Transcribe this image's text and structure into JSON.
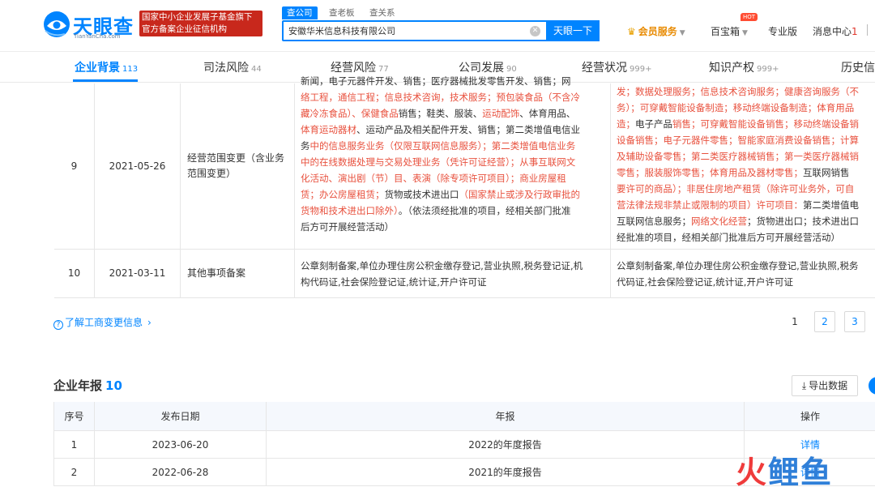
{
  "header": {
    "logo_name": "天眼查",
    "logo_sub": "TianYanCha.com",
    "gov_badge_line1": "国家中小企业发展子基金旗下",
    "gov_badge_line2": "官方备案企业征信机构",
    "search_tabs": [
      "查公司",
      "查老板",
      "查关系"
    ],
    "search_value": "安徽华米信息科技有限公司",
    "search_button": "天眼一下",
    "vip": "会员服务",
    "baibaoxiang": "百宝箱",
    "hot": "HOT",
    "pro": "专业版",
    "messages": "消息中心",
    "message_count": "1"
  },
  "tabs": [
    {
      "label": "企业背景",
      "count": "113"
    },
    {
      "label": "司法风险",
      "count": "44"
    },
    {
      "label": "经营风险",
      "count": "77"
    },
    {
      "label": "公司发展",
      "count": "90"
    },
    {
      "label": "经营状况",
      "count": "999+"
    },
    {
      "label": "知识产权",
      "count": "999+"
    },
    {
      "label": "历史信",
      "count": ""
    }
  ],
  "change_rows": [
    {
      "no": "9",
      "date": "2021-05-26",
      "item": "经营范围变更（含业务范围变更）",
      "before_lines": [
        [
          [
            "新闻，电子元器件开发、销售；医疗器械批发零售开发、销售；网",
            false
          ]
        ],
        [
          [
            "络工程，通信工程；信息技术咨询，技术服务；预包装食品（不含冷",
            true
          ]
        ],
        [
          [
            "藏冷冻食品）、保健食品",
            true
          ],
          [
            "销售；鞋类、服装、",
            false
          ],
          [
            "运动配饰",
            true
          ],
          [
            "、体育用品、",
            false
          ]
        ],
        [
          [
            "体育运动器材",
            true
          ],
          [
            "、运动产品及相关配件开发、销售；第二类增值电信业",
            false
          ]
        ],
        [
          [
            "务",
            false
          ],
          [
            "中的信息服务业务（仅限互联网信息服务）；第二类增值电信业务",
            true
          ]
        ],
        [
          [
            "中的在线数据处理与交易处理业务（凭许可证经营）；从事互联网文",
            true
          ]
        ],
        [
          [
            "化活动、演出剧（节）目、表演（除专项许可项目）；商业房屋租",
            true
          ]
        ],
        [
          [
            "赁；办公房屋租赁；",
            true
          ],
          [
            "货物或技术进出口",
            false
          ],
          [
            "（国家禁止或涉及行政审批的",
            true
          ]
        ],
        [
          [
            "货物和技术进出口除外）",
            true
          ],
          [
            "。（依法须经批准的项目，经相关部门批准",
            false
          ]
        ],
        [
          [
            "后方可开展经营活动）",
            false
          ]
        ]
      ],
      "after_lines": [
        [
          [
            "发；数据处理服务；信息技术咨询服务；健康咨询服务（不",
            true
          ]
        ],
        [
          [
            "务）；可穿戴智能设备制造；移动终端设备制造；体育用品",
            true
          ]
        ],
        [
          [
            "造；",
            true
          ],
          [
            "电子产品",
            false
          ],
          [
            "销售；可穿戴智能设备销售；移动终端设备销",
            true
          ]
        ],
        [
          [
            "设备销售；电子元器件零售；智能家庭消费设备销售；计算",
            true
          ]
        ],
        [
          [
            "及辅助设备零售；第二类医疗器械销售；第一类医疗器械销",
            true
          ]
        ],
        [
          [
            "零售；服装服饰零售；体育用品及器材零售；",
            true
          ],
          [
            "互联网销售",
            false
          ]
        ],
        [
          [
            "要许可的商品）；非居住房地产租赁（除许可业务外，可自",
            true
          ]
        ],
        [
          [
            "营法律法规非禁止或限制的项目）许可项目：",
            true
          ],
          [
            "第二类增值电",
            false
          ]
        ],
        [
          [
            "互联网信息服务；",
            false
          ],
          [
            "网络文化经营",
            true
          ],
          [
            "；货物进出口；技术进出口",
            false
          ]
        ],
        [
          [
            "经批准的项目，经相关部门批准后方可开展经营活动）",
            false
          ]
        ]
      ]
    },
    {
      "no": "10",
      "date": "2021-03-11",
      "item": "其他事项备案",
      "before_lines": [
        [
          [
            "公章刻制备案,单位办理住房公积金缴存登记,营业执照,税务登记证,机",
            false
          ]
        ],
        [
          [
            "构代码证,社会保险登记证,统计证,开户许可证",
            false
          ]
        ]
      ],
      "after_lines": [
        [
          [
            "公章刻制备案,单位办理住房公积金缴存登记,营业执照,税务",
            false
          ]
        ],
        [
          [
            "代码证,社会保险登记证,统计证,开户许可证",
            false
          ]
        ]
      ]
    }
  ],
  "info_link": "了解工商变更信息",
  "pagination": [
    "1",
    "2",
    "3"
  ],
  "annual_report": {
    "title": "企业年报",
    "count": "10",
    "export": "导出数据",
    "headers": [
      "序号",
      "发布日期",
      "年报",
      "操作"
    ],
    "rows": [
      {
        "no": "1",
        "date": "2023-06-20",
        "name": "2022的年度报告",
        "action": "详情"
      },
      {
        "no": "2",
        "date": "2022-06-28",
        "name": "2021的年度报告",
        "action": "详情"
      }
    ]
  },
  "watermark": {
    "a": "火",
    "b": "鲤鱼"
  },
  "colors": {
    "brand": "#0084ff",
    "highlight": "#e8513e",
    "gov_red": "#c8281c"
  }
}
